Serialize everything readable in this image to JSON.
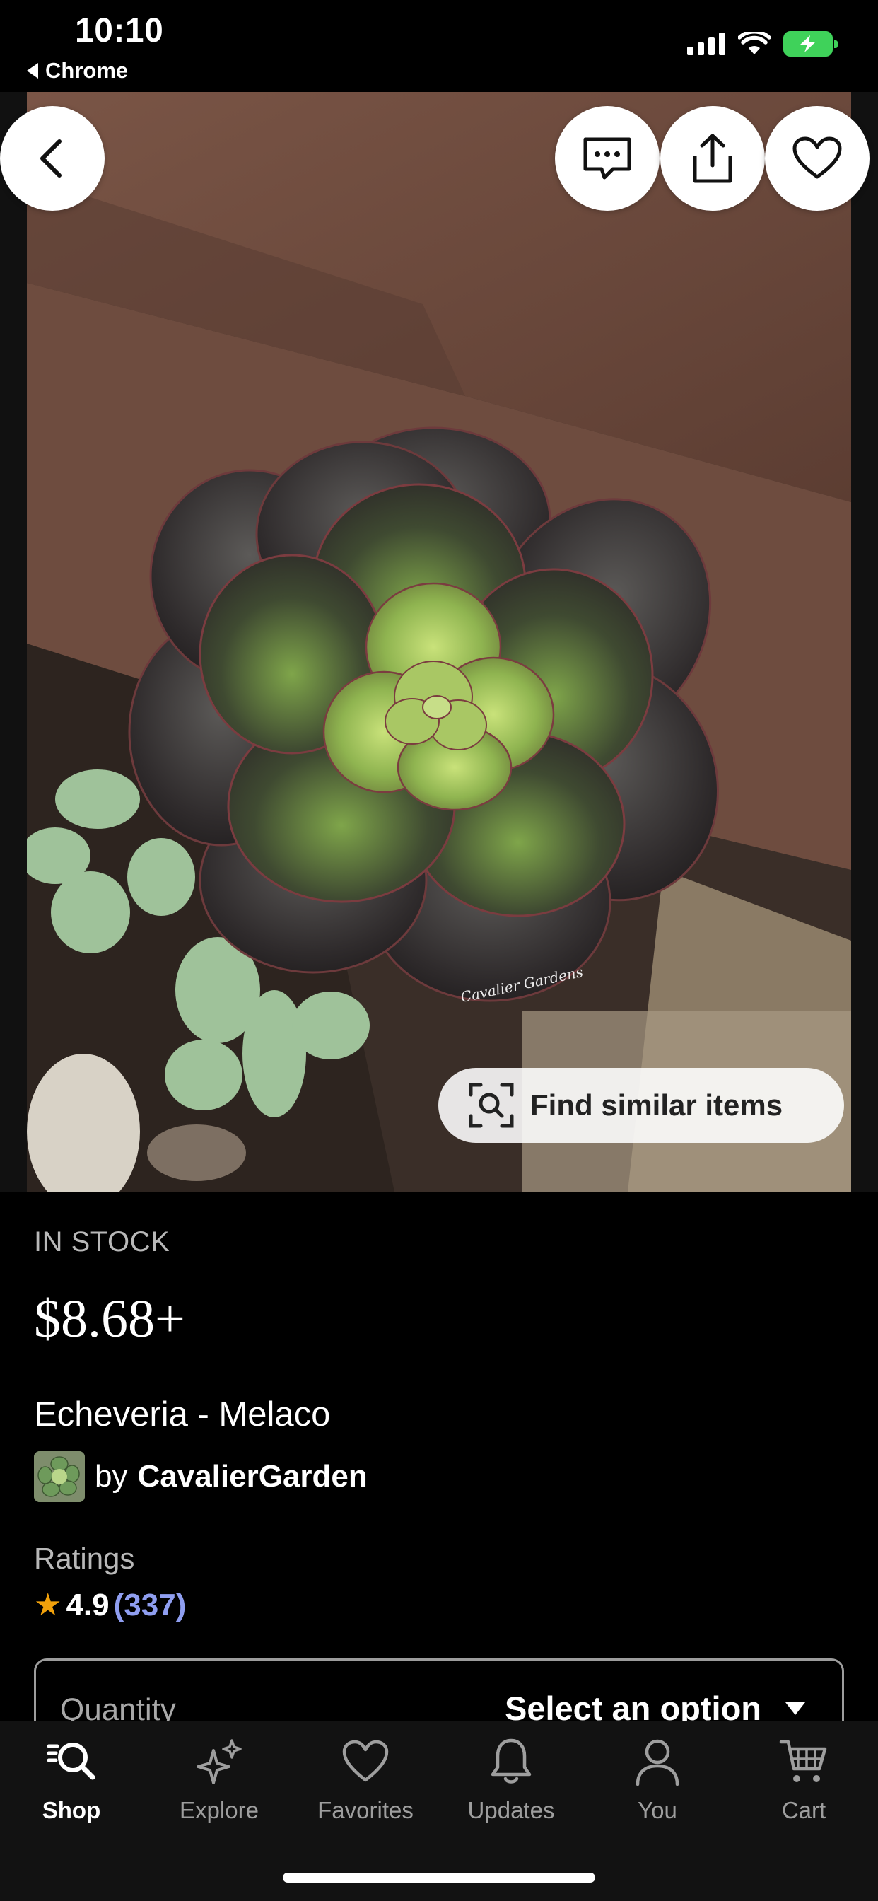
{
  "status_bar": {
    "time": "10:10",
    "back_app": "Chrome",
    "battery_color": "#3fd25a"
  },
  "hero": {
    "watermark": "Cavalier Gardens",
    "buttons": {
      "back_icon": "chevron-left-icon",
      "message_icon": "message-icon",
      "share_icon": "share-icon",
      "favorite_icon": "heart-icon"
    },
    "find_similar_label": "Find similar items",
    "find_similar_icon": "visual-search-icon"
  },
  "listing": {
    "stock_status": "IN STOCK",
    "price": "$8.68+",
    "title": "Echeveria - Melaco",
    "shop_by": "by",
    "shop_name": "CavalierGarden",
    "ratings_label": "Ratings",
    "rating_value": "4.9",
    "rating_count": "(337)",
    "star_color": "#f1a10b",
    "count_color": "#8f9ef0"
  },
  "quantity": {
    "label": "Quantity",
    "selected_value": "Select an option"
  },
  "tab_bar": {
    "tabs": [
      {
        "label": "Shop",
        "icon": "search-icon",
        "active": true
      },
      {
        "label": "Explore",
        "icon": "sparkles-icon",
        "active": false
      },
      {
        "label": "Favorites",
        "icon": "heart-icon",
        "active": false
      },
      {
        "label": "Updates",
        "icon": "bell-icon",
        "active": false
      },
      {
        "label": "You",
        "icon": "person-icon",
        "active": false
      },
      {
        "label": "Cart",
        "icon": "cart-icon",
        "active": false
      }
    ]
  }
}
